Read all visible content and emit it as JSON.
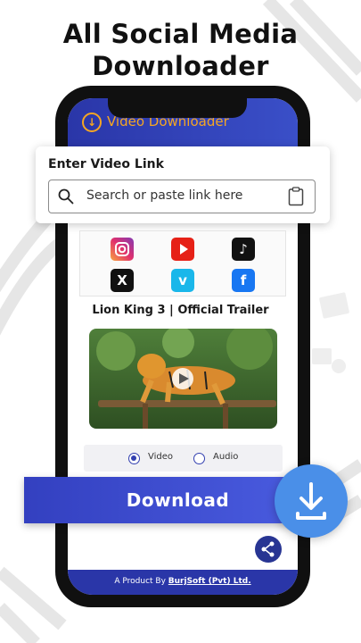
{
  "headline": {
    "line1": "All Social Media",
    "line2": "Downloader"
  },
  "app": {
    "title": "Video Downloader",
    "logo_icon": "download-icon"
  },
  "link_card": {
    "title": "Enter Video Link",
    "placeholder": "Search or paste link here",
    "paste_icon": "clipboard-icon"
  },
  "platforms": [
    {
      "name": "instagram",
      "color": "#d6249f"
    },
    {
      "name": "youtube",
      "color": "#e62117"
    },
    {
      "name": "tiktok",
      "color": "#111111"
    },
    {
      "name": "x",
      "color": "#111111"
    },
    {
      "name": "vimeo",
      "color": "#1ab7ea"
    },
    {
      "name": "facebook",
      "color": "#1877f2"
    }
  ],
  "video": {
    "title": "Lion King 3 |  Official Trailer"
  },
  "format": {
    "options": [
      "Video",
      "Audio"
    ],
    "selected": "Video"
  },
  "download": {
    "label": "Download"
  },
  "footer": {
    "prefix": "A Product By ",
    "brand": "BurjSoft (Pvt) Ltd."
  },
  "colors": {
    "primary": "#3340c0",
    "accent": "#f5a623",
    "download_circle": "#4a8fe8"
  }
}
